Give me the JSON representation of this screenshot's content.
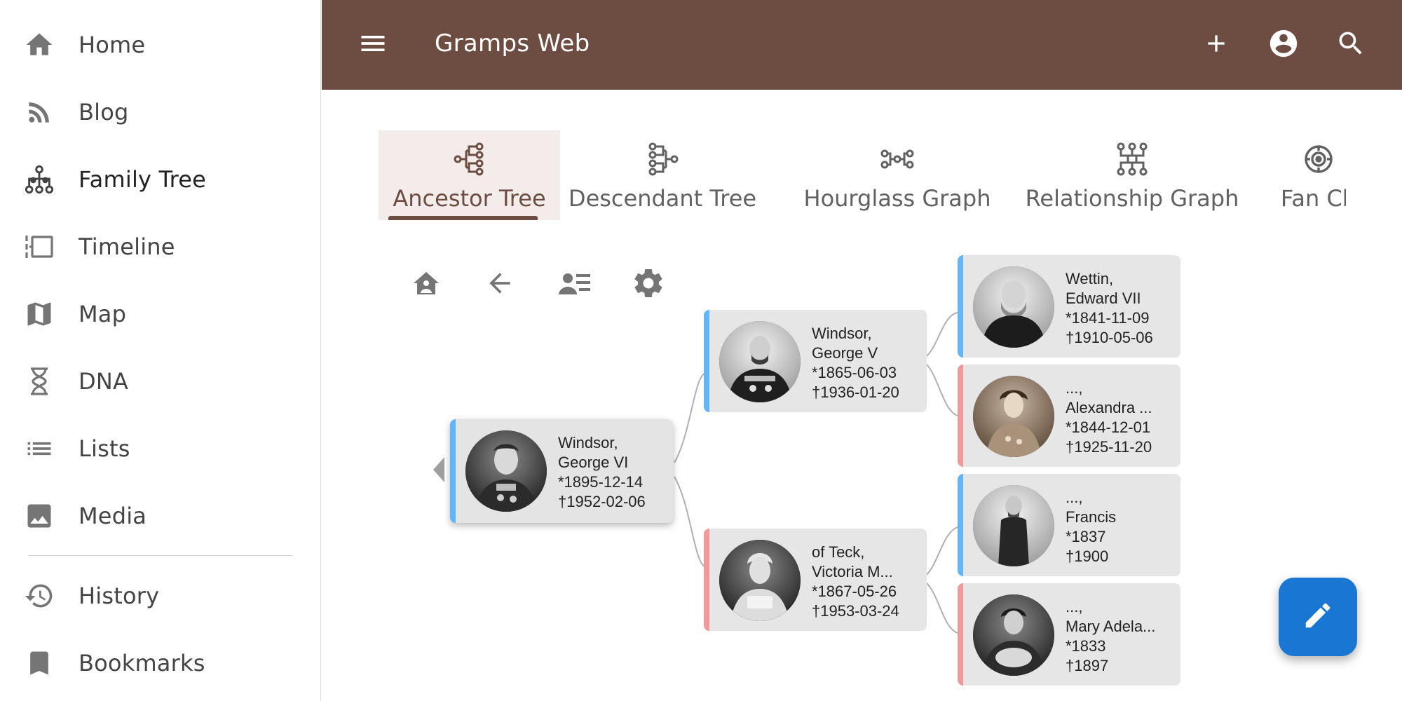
{
  "sidebar": {
    "items": [
      {
        "label": "Home",
        "icon": "home-icon"
      },
      {
        "label": "Blog",
        "icon": "rss-icon"
      },
      {
        "label": "Family Tree",
        "icon": "family-tree-icon",
        "active": true
      },
      {
        "label": "Timeline",
        "icon": "timeline-icon"
      },
      {
        "label": "Map",
        "icon": "map-icon"
      },
      {
        "label": "DNA",
        "icon": "dna-icon"
      },
      {
        "label": "Lists",
        "icon": "list-icon"
      },
      {
        "label": "Media",
        "icon": "image-icon"
      },
      {
        "label": "History",
        "icon": "history-icon"
      },
      {
        "label": "Bookmarks",
        "icon": "bookmark-icon"
      }
    ]
  },
  "appbar": {
    "title": "Gramps Web",
    "color": "#6d4c41",
    "actions": [
      "menu-icon",
      "add-icon",
      "account-icon",
      "search-icon"
    ]
  },
  "tabs": [
    {
      "label": "Ancestor Tree",
      "active": true
    },
    {
      "label": "Descendant Tree"
    },
    {
      "label": "Hourglass Graph"
    },
    {
      "label": "Relationship Graph"
    },
    {
      "label": "Fan Ch"
    }
  ],
  "toolbar": [
    "home-person-icon",
    "back-icon",
    "person-details-icon",
    "settings-icon"
  ],
  "tree": {
    "root": {
      "surname": "Windsor,",
      "given": "George VI",
      "birth": "*1895-12-14",
      "death": "†1952-02-06",
      "sex": "male"
    },
    "parents": [
      {
        "surname": "Windsor,",
        "given": "George V",
        "birth": "*1865-06-03",
        "death": "†1936-01-20",
        "sex": "male"
      },
      {
        "surname": "of Teck,",
        "given": "Victoria M...",
        "birth": "*1867-05-26",
        "death": "†1953-03-24",
        "sex": "female"
      }
    ],
    "grandparents": [
      {
        "surname": "Wettin,",
        "given": "Edward VII",
        "birth": "*1841-11-09",
        "death": "†1910-05-06",
        "sex": "male"
      },
      {
        "surname": "...,",
        "given": "Alexandra ...",
        "birth": "*1844-12-01",
        "death": "†1925-11-20",
        "sex": "female"
      },
      {
        "surname": "...,",
        "given": "Francis",
        "birth": "*1837",
        "death": "†1900",
        "sex": "male"
      },
      {
        "surname": "...,",
        "given": "Mary Adela...",
        "birth": "*1833",
        "death": "†1897",
        "sex": "female"
      }
    ]
  },
  "fab": {
    "icon": "edit-icon",
    "color": "#1976d2"
  }
}
